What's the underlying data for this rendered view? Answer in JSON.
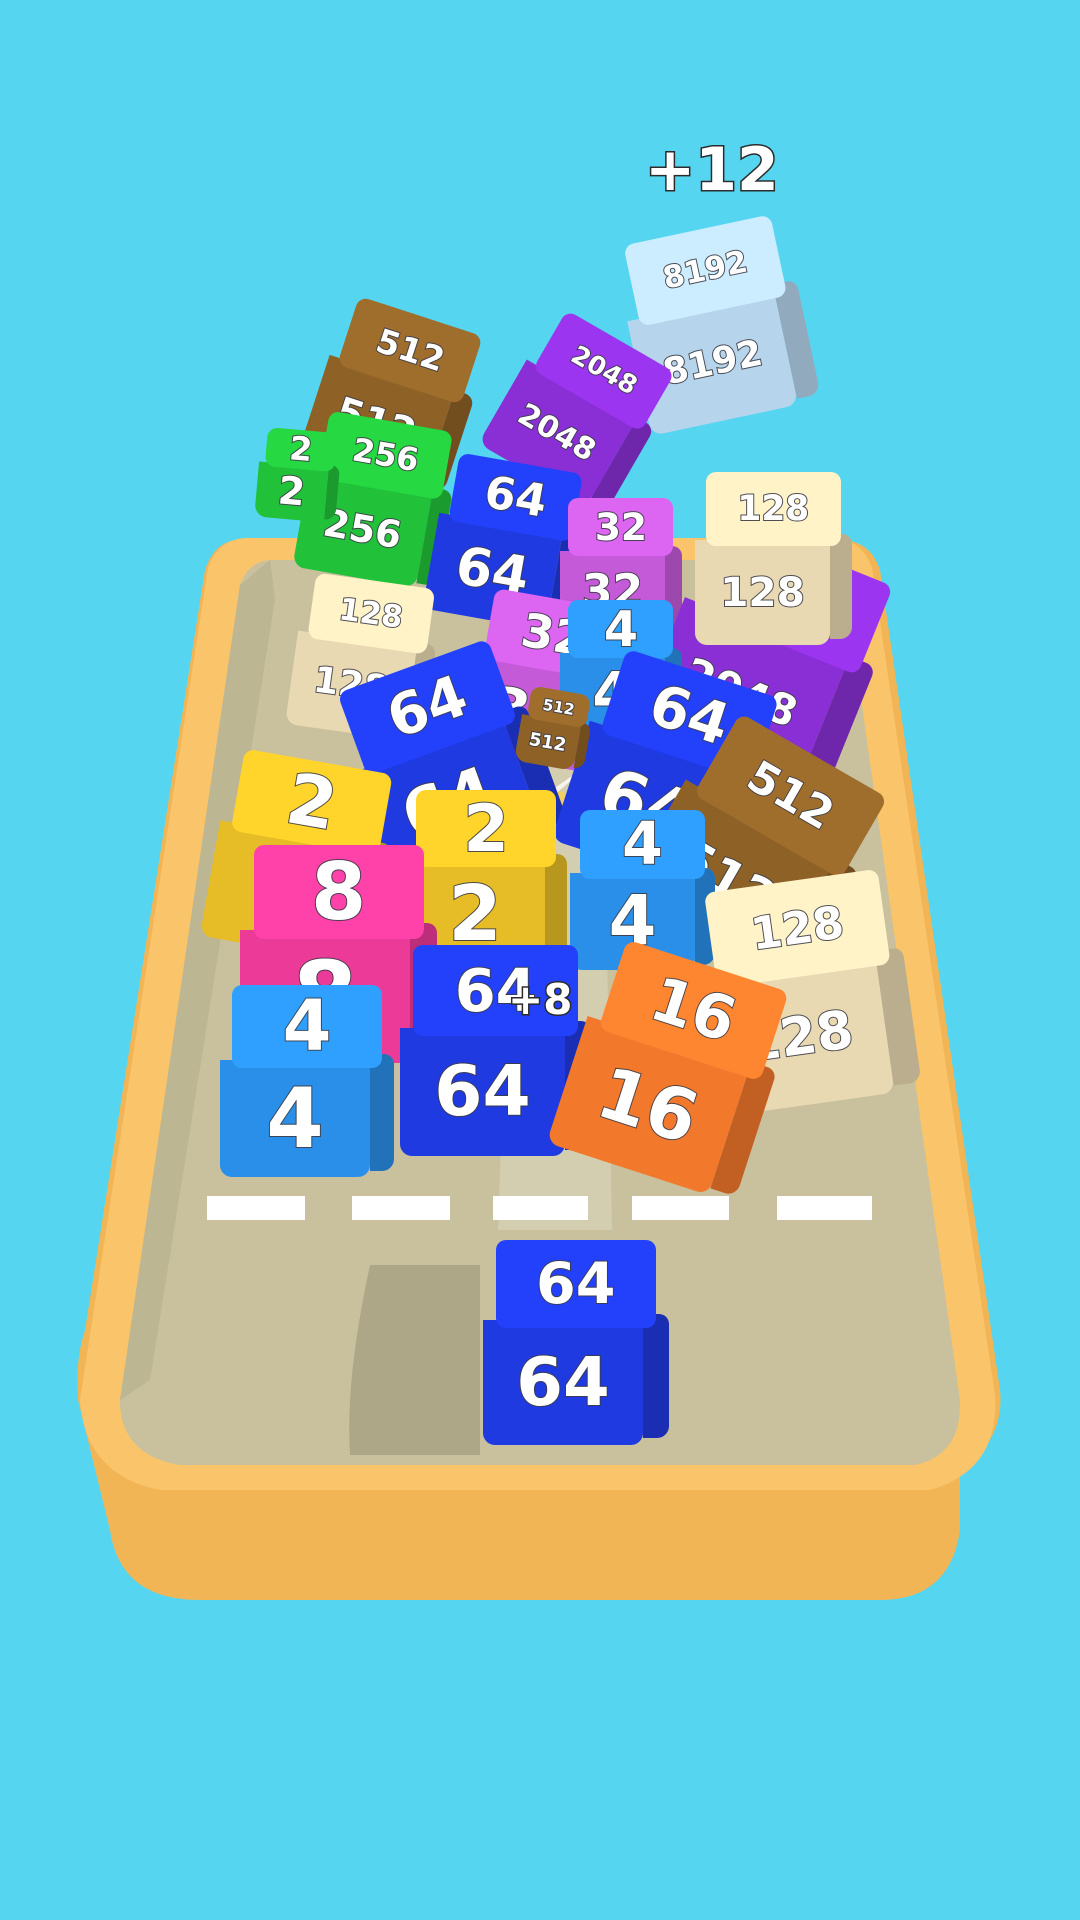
{
  "game": {
    "score_popups": {
      "main": "+12",
      "combo": "+8"
    },
    "launcher_cube": {
      "value": "64",
      "color": "#1f3ae0"
    },
    "cubes": [
      {
        "value": "8192",
        "color": "#b6d4ec"
      },
      {
        "value": "2048",
        "color": "#8a2fd6"
      },
      {
        "value": "512",
        "color": "#8e6227"
      },
      {
        "value": "256",
        "color": "#22c13a"
      },
      {
        "value": "2",
        "color": "#22c13a"
      },
      {
        "value": "64",
        "color": "#1f3ae0"
      },
      {
        "value": "32",
        "color": "#c45ad8"
      },
      {
        "value": "128",
        "color": "#e9d9b2"
      },
      {
        "value": "2048",
        "color": "#8a2fd6"
      },
      {
        "value": "128",
        "color": "#e9d9b2"
      },
      {
        "value": "32",
        "color": "#c45ad8"
      },
      {
        "value": "4",
        "color": "#2a8fe8"
      },
      {
        "value": "64",
        "color": "#1f3ae0"
      },
      {
        "value": "64",
        "color": "#1f3ae0"
      },
      {
        "value": "512",
        "color": "#8e6227"
      },
      {
        "value": "2",
        "color": "#e6bd26"
      },
      {
        "value": "2",
        "color": "#e6bd26"
      },
      {
        "value": "4",
        "color": "#2a8fe8"
      },
      {
        "value": "8",
        "color": "#ec3a98"
      },
      {
        "value": "128",
        "color": "#e9d9b2"
      },
      {
        "value": "4",
        "color": "#2a8fe8"
      },
      {
        "value": "64",
        "color": "#1f3ae0"
      },
      {
        "value": "16",
        "color": "#f2782c"
      },
      {
        "value": "512",
        "color": "#8e6227"
      }
    ]
  },
  "colors": {
    "background": "#55d5f0",
    "board_rim": "#f6bc5e",
    "board_floor": "#cbc3a0",
    "lane_marker": "#ffffff"
  }
}
